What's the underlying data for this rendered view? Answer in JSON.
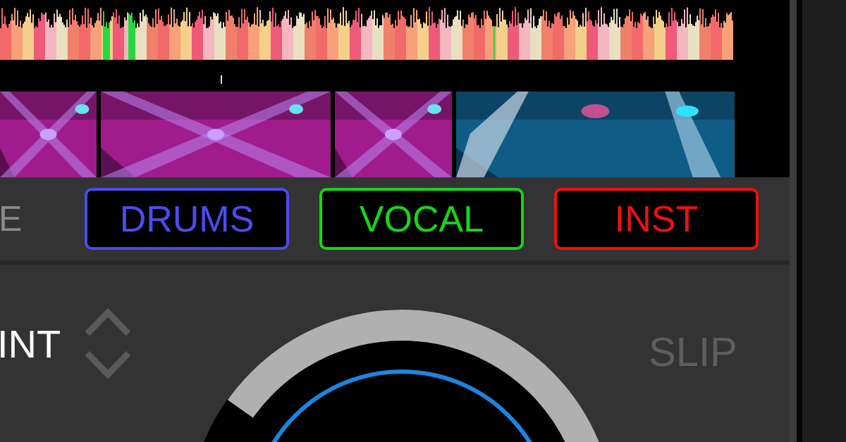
{
  "stems_label_partial": "E",
  "stems": [
    {
      "label": "DRUMS",
      "color": "#4a4cf0"
    },
    {
      "label": "VOCAL",
      "color": "#16d616"
    },
    {
      "label": "INST",
      "color": "#f01010"
    }
  ],
  "deck": {
    "cue_label_partial": "INT",
    "slip": "SLIP"
  }
}
